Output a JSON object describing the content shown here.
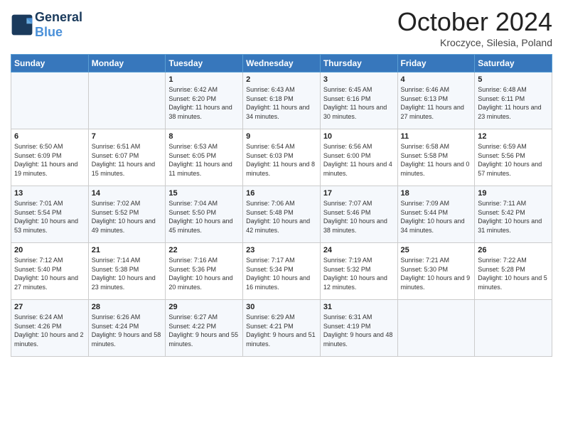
{
  "header": {
    "logo_line1": "General",
    "logo_line2": "Blue",
    "month": "October 2024",
    "location": "Kroczyce, Silesia, Poland"
  },
  "days_of_week": [
    "Sunday",
    "Monday",
    "Tuesday",
    "Wednesday",
    "Thursday",
    "Friday",
    "Saturday"
  ],
  "weeks": [
    [
      {
        "day": "",
        "info": ""
      },
      {
        "day": "",
        "info": ""
      },
      {
        "day": "1",
        "info": "Sunrise: 6:42 AM\nSunset: 6:20 PM\nDaylight: 11 hours and 38 minutes."
      },
      {
        "day": "2",
        "info": "Sunrise: 6:43 AM\nSunset: 6:18 PM\nDaylight: 11 hours and 34 minutes."
      },
      {
        "day": "3",
        "info": "Sunrise: 6:45 AM\nSunset: 6:16 PM\nDaylight: 11 hours and 30 minutes."
      },
      {
        "day": "4",
        "info": "Sunrise: 6:46 AM\nSunset: 6:13 PM\nDaylight: 11 hours and 27 minutes."
      },
      {
        "day": "5",
        "info": "Sunrise: 6:48 AM\nSunset: 6:11 PM\nDaylight: 11 hours and 23 minutes."
      }
    ],
    [
      {
        "day": "6",
        "info": "Sunrise: 6:50 AM\nSunset: 6:09 PM\nDaylight: 11 hours and 19 minutes."
      },
      {
        "day": "7",
        "info": "Sunrise: 6:51 AM\nSunset: 6:07 PM\nDaylight: 11 hours and 15 minutes."
      },
      {
        "day": "8",
        "info": "Sunrise: 6:53 AM\nSunset: 6:05 PM\nDaylight: 11 hours and 11 minutes."
      },
      {
        "day": "9",
        "info": "Sunrise: 6:54 AM\nSunset: 6:03 PM\nDaylight: 11 hours and 8 minutes."
      },
      {
        "day": "10",
        "info": "Sunrise: 6:56 AM\nSunset: 6:00 PM\nDaylight: 11 hours and 4 minutes."
      },
      {
        "day": "11",
        "info": "Sunrise: 6:58 AM\nSunset: 5:58 PM\nDaylight: 11 hours and 0 minutes."
      },
      {
        "day": "12",
        "info": "Sunrise: 6:59 AM\nSunset: 5:56 PM\nDaylight: 10 hours and 57 minutes."
      }
    ],
    [
      {
        "day": "13",
        "info": "Sunrise: 7:01 AM\nSunset: 5:54 PM\nDaylight: 10 hours and 53 minutes."
      },
      {
        "day": "14",
        "info": "Sunrise: 7:02 AM\nSunset: 5:52 PM\nDaylight: 10 hours and 49 minutes."
      },
      {
        "day": "15",
        "info": "Sunrise: 7:04 AM\nSunset: 5:50 PM\nDaylight: 10 hours and 45 minutes."
      },
      {
        "day": "16",
        "info": "Sunrise: 7:06 AM\nSunset: 5:48 PM\nDaylight: 10 hours and 42 minutes."
      },
      {
        "day": "17",
        "info": "Sunrise: 7:07 AM\nSunset: 5:46 PM\nDaylight: 10 hours and 38 minutes."
      },
      {
        "day": "18",
        "info": "Sunrise: 7:09 AM\nSunset: 5:44 PM\nDaylight: 10 hours and 34 minutes."
      },
      {
        "day": "19",
        "info": "Sunrise: 7:11 AM\nSunset: 5:42 PM\nDaylight: 10 hours and 31 minutes."
      }
    ],
    [
      {
        "day": "20",
        "info": "Sunrise: 7:12 AM\nSunset: 5:40 PM\nDaylight: 10 hours and 27 minutes."
      },
      {
        "day": "21",
        "info": "Sunrise: 7:14 AM\nSunset: 5:38 PM\nDaylight: 10 hours and 23 minutes."
      },
      {
        "day": "22",
        "info": "Sunrise: 7:16 AM\nSunset: 5:36 PM\nDaylight: 10 hours and 20 minutes."
      },
      {
        "day": "23",
        "info": "Sunrise: 7:17 AM\nSunset: 5:34 PM\nDaylight: 10 hours and 16 minutes."
      },
      {
        "day": "24",
        "info": "Sunrise: 7:19 AM\nSunset: 5:32 PM\nDaylight: 10 hours and 12 minutes."
      },
      {
        "day": "25",
        "info": "Sunrise: 7:21 AM\nSunset: 5:30 PM\nDaylight: 10 hours and 9 minutes."
      },
      {
        "day": "26",
        "info": "Sunrise: 7:22 AM\nSunset: 5:28 PM\nDaylight: 10 hours and 5 minutes."
      }
    ],
    [
      {
        "day": "27",
        "info": "Sunrise: 6:24 AM\nSunset: 4:26 PM\nDaylight: 10 hours and 2 minutes."
      },
      {
        "day": "28",
        "info": "Sunrise: 6:26 AM\nSunset: 4:24 PM\nDaylight: 9 hours and 58 minutes."
      },
      {
        "day": "29",
        "info": "Sunrise: 6:27 AM\nSunset: 4:22 PM\nDaylight: 9 hours and 55 minutes."
      },
      {
        "day": "30",
        "info": "Sunrise: 6:29 AM\nSunset: 4:21 PM\nDaylight: 9 hours and 51 minutes."
      },
      {
        "day": "31",
        "info": "Sunrise: 6:31 AM\nSunset: 4:19 PM\nDaylight: 9 hours and 48 minutes."
      },
      {
        "day": "",
        "info": ""
      },
      {
        "day": "",
        "info": ""
      }
    ]
  ]
}
